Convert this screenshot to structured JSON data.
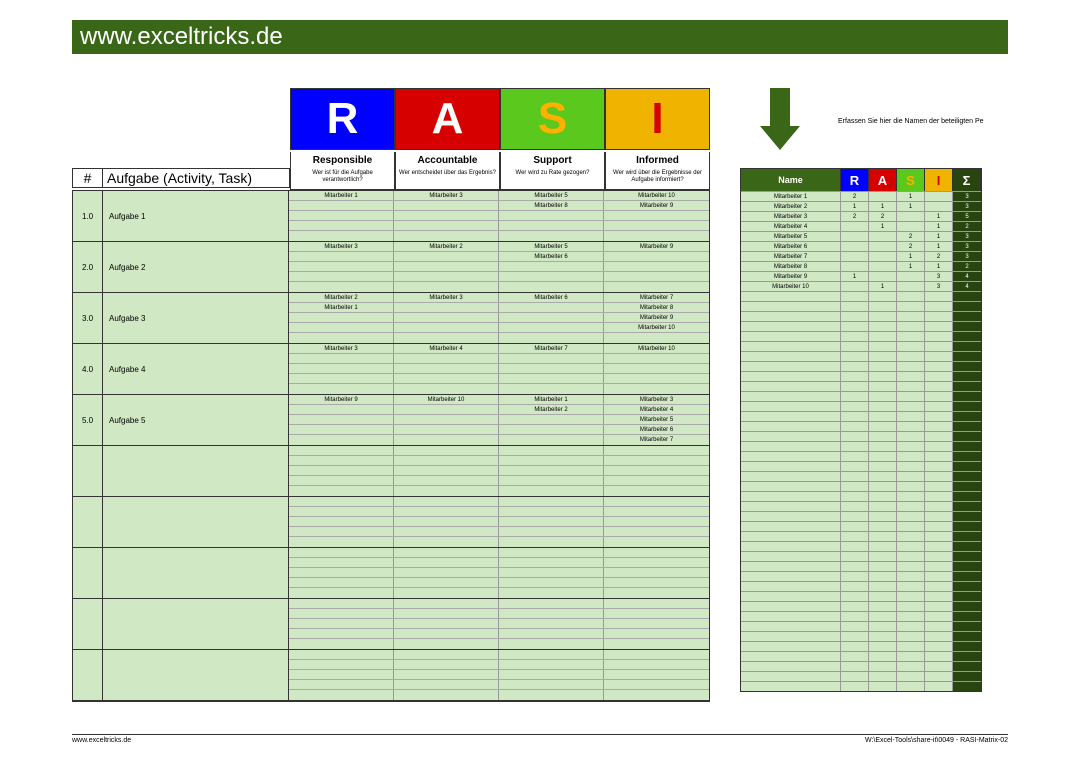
{
  "header": "www.exceltricks.de",
  "instruction": "Erfassen Sie hier die Namen der beteiligten Pe",
  "rasi_letters": {
    "r": "R",
    "a": "A",
    "s": "S",
    "i": "I"
  },
  "roles": {
    "r": {
      "label": "Responsible",
      "desc": "Wer ist für die Aufgabe verantwortlich?"
    },
    "a": {
      "label": "Accountable",
      "desc": "Wer entscheidet über das Ergebnis?"
    },
    "s": {
      "label": "Support",
      "desc": "Wer wird zu Rate gezogen?"
    },
    "i": {
      "label": "Informed",
      "desc": "Wer wird über die Ergebnisse der Aufgabe informiert?"
    }
  },
  "task_header": {
    "num": "#",
    "label": "Aufgabe (Activity, Task)"
  },
  "tasks": [
    {
      "id": "1.0",
      "name": "Aufgabe 1",
      "rows": [
        [
          "Mitarbeiter 1",
          "Mitarbeiter 3",
          "Mitarbeiter 5",
          "Mitarbeiter 10"
        ],
        [
          "",
          "",
          "Mitarbeiter 8",
          "Mitarbeiter 9"
        ],
        [
          "",
          "",
          "",
          ""
        ],
        [
          "",
          "",
          "",
          ""
        ],
        [
          "",
          "",
          "",
          ""
        ]
      ]
    },
    {
      "id": "2.0",
      "name": "Aufgabe 2",
      "rows": [
        [
          "Mitarbeiter 3",
          "Mitarbeiter 2",
          "Mitarbeiter 5",
          "Mitarbeiter 9"
        ],
        [
          "",
          "",
          "Mitarbeiter 6",
          ""
        ],
        [
          "",
          "",
          "",
          ""
        ],
        [
          "",
          "",
          "",
          ""
        ],
        [
          "",
          "",
          "",
          ""
        ]
      ]
    },
    {
      "id": "3.0",
      "name": "Aufgabe 3",
      "rows": [
        [
          "Mitarbeiter 2",
          "Mitarbeiter 3",
          "Mitarbeiter 6",
          "Mitarbeiter 7"
        ],
        [
          "Mitarbeiter 1",
          "",
          "",
          "Mitarbeiter 8"
        ],
        [
          "",
          "",
          "",
          "Mitarbeiter 9"
        ],
        [
          "",
          "",
          "",
          "Mitarbeiter 10"
        ],
        [
          "",
          "",
          "",
          ""
        ]
      ]
    },
    {
      "id": "4.0",
      "name": "Aufgabe 4",
      "rows": [
        [
          "Mitarbeiter 3",
          "Mitarbeiter 4",
          "Mitarbeiter 7",
          "Mitarbeiter 10"
        ],
        [
          "",
          "",
          "",
          ""
        ],
        [
          "",
          "",
          "",
          ""
        ],
        [
          "",
          "",
          "",
          ""
        ],
        [
          "",
          "",
          "",
          ""
        ]
      ]
    },
    {
      "id": "5.0",
      "name": "Aufgabe 5",
      "rows": [
        [
          "Mitarbeiter 9",
          "Mitarbeiter 10",
          "Mitarbeiter 1",
          "Mitarbeiter 3"
        ],
        [
          "",
          "",
          "Mitarbeiter 2",
          "Mitarbeiter 4"
        ],
        [
          "",
          "",
          "",
          "Mitarbeiter 5"
        ],
        [
          "",
          "",
          "",
          "Mitarbeiter 6"
        ],
        [
          "",
          "",
          "",
          "Mitarbeiter 7"
        ]
      ]
    },
    {
      "id": "",
      "name": "",
      "rows": [
        [
          "",
          "",
          "",
          ""
        ],
        [
          "",
          "",
          "",
          ""
        ],
        [
          "",
          "",
          "",
          ""
        ],
        [
          "",
          "",
          "",
          ""
        ],
        [
          "",
          "",
          "",
          ""
        ]
      ]
    },
    {
      "id": "",
      "name": "",
      "rows": [
        [
          "",
          "",
          "",
          ""
        ],
        [
          "",
          "",
          "",
          ""
        ],
        [
          "",
          "",
          "",
          ""
        ],
        [
          "",
          "",
          "",
          ""
        ],
        [
          "",
          "",
          "",
          ""
        ]
      ]
    },
    {
      "id": "",
      "name": "",
      "rows": [
        [
          "",
          "",
          "",
          ""
        ],
        [
          "",
          "",
          "",
          ""
        ],
        [
          "",
          "",
          "",
          ""
        ],
        [
          "",
          "",
          "",
          ""
        ],
        [
          "",
          "",
          "",
          ""
        ]
      ]
    },
    {
      "id": "",
      "name": "",
      "rows": [
        [
          "",
          "",
          "",
          ""
        ],
        [
          "",
          "",
          "",
          ""
        ],
        [
          "",
          "",
          "",
          ""
        ],
        [
          "",
          "",
          "",
          ""
        ],
        [
          "",
          "",
          "",
          ""
        ]
      ]
    },
    {
      "id": "",
      "name": "",
      "rows": [
        [
          "",
          "",
          "",
          ""
        ],
        [
          "",
          "",
          "",
          ""
        ],
        [
          "",
          "",
          "",
          ""
        ],
        [
          "",
          "",
          "",
          ""
        ],
        [
          "",
          "",
          "",
          ""
        ]
      ]
    }
  ],
  "summary_header": {
    "name": "Name",
    "r": "R",
    "a": "A",
    "s": "S",
    "i": "I",
    "sigma": "Σ"
  },
  "summary_rows": [
    {
      "name": "Mitarbeiter 1",
      "r": "2",
      "a": "",
      "s": "1",
      "i": "",
      "t": "3"
    },
    {
      "name": "Mitarbeiter 2",
      "r": "1",
      "a": "1",
      "s": "1",
      "i": "",
      "t": "3"
    },
    {
      "name": "Mitarbeiter 3",
      "r": "2",
      "a": "2",
      "s": "",
      "i": "1",
      "t": "5"
    },
    {
      "name": "Mitarbeiter 4",
      "r": "",
      "a": "1",
      "s": "",
      "i": "1",
      "t": "2"
    },
    {
      "name": "Mitarbeiter 5",
      "r": "",
      "a": "",
      "s": "2",
      "i": "1",
      "t": "3"
    },
    {
      "name": "Mitarbeiter 6",
      "r": "",
      "a": "",
      "s": "2",
      "i": "1",
      "t": "3"
    },
    {
      "name": "Mitarbeiter 7",
      "r": "",
      "a": "",
      "s": "1",
      "i": "2",
      "t": "3"
    },
    {
      "name": "Mitarbeiter 8",
      "r": "",
      "a": "",
      "s": "1",
      "i": "1",
      "t": "2"
    },
    {
      "name": "Mitarbeiter 9",
      "r": "1",
      "a": "",
      "s": "",
      "i": "3",
      "t": "4"
    },
    {
      "name": "Mitarbeiter 10",
      "r": "",
      "a": "1",
      "s": "",
      "i": "3",
      "t": "4"
    }
  ],
  "summary_empty_rows": 40,
  "footer": {
    "left": "www.exceltricks.de",
    "right": "W:\\Excel-Tools\\share-it\\0049 - RASI-Matrix-02"
  }
}
